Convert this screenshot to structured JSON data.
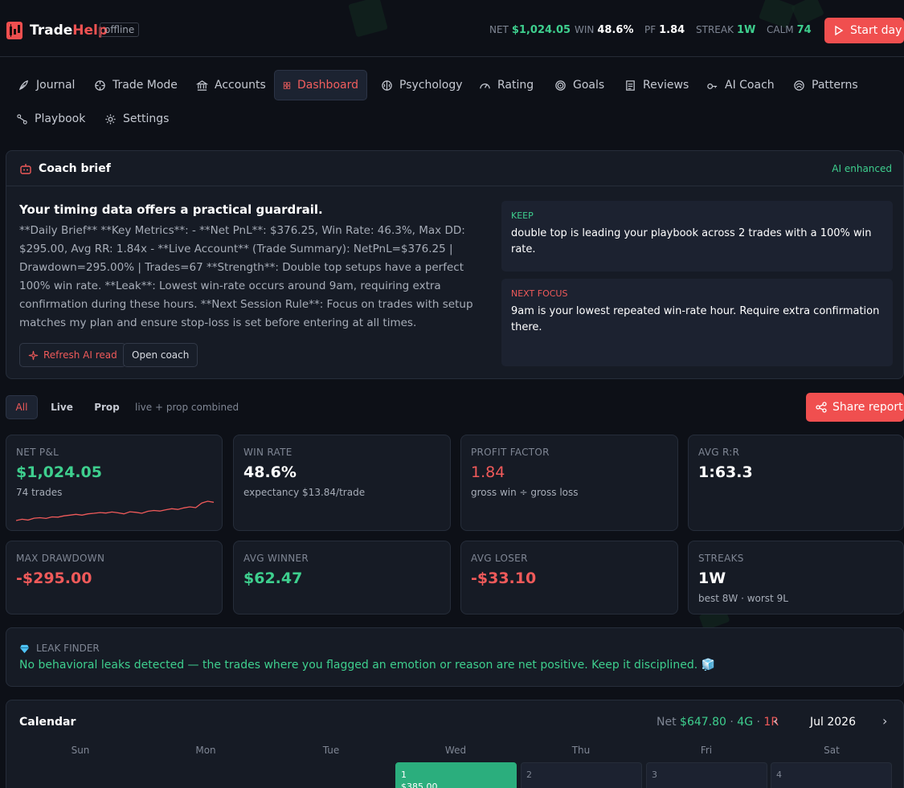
{
  "header": {
    "brand_part1": "Trade",
    "brand_part2": "Help",
    "status_badge": "offline",
    "stats": [
      {
        "label": "NET",
        "value": "$1,024.05",
        "color": "#3ecf8e"
      },
      {
        "label": "WIN",
        "value": "48.6%",
        "color": "#ffffff"
      },
      {
        "label": "PF",
        "value": "1.84",
        "color": "#ffffff"
      },
      {
        "label": "STREAK",
        "value": "1W",
        "color": "#3ecf8e"
      },
      {
        "label": "CALM",
        "value": "74",
        "color": "#3ecf8e"
      }
    ],
    "start_day_label": "Start day"
  },
  "nav": [
    {
      "label": "Journal",
      "icon": "feather-icon"
    },
    {
      "label": "Trade Mode",
      "icon": "crosshair-icon"
    },
    {
      "label": "Accounts",
      "icon": "bank-icon"
    },
    {
      "label": "Dashboard",
      "icon": "grid-icon",
      "active": true
    },
    {
      "label": "Psychology",
      "icon": "brain-icon"
    },
    {
      "label": "Rating",
      "icon": "gauge-icon"
    },
    {
      "label": "Goals",
      "icon": "target-icon"
    },
    {
      "label": "Reviews",
      "icon": "review-icon"
    },
    {
      "label": "AI Coach",
      "icon": "key-icon"
    },
    {
      "label": "Patterns",
      "icon": "pattern-icon"
    },
    {
      "label": "Playbook",
      "icon": "route-icon"
    },
    {
      "label": "Settings",
      "icon": "gear-icon"
    }
  ],
  "coach": {
    "title": "Coach brief",
    "badge": "AI enhanced",
    "headline": "Your timing data offers a practical guardrail.",
    "body": "**Daily Brief** **Key Metrics**: - **Net PnL**: $376.25, Win Rate: 46.3%, Max DD: $295.00, Avg RR: 1.84x - **Live Account** (Trade Summary): NetPnL=$376.25 | Drawdown=295.00% | Trades=67 **Strength**: Double top setups have a perfect 100% win rate. **Leak**: Lowest win-rate occurs around 9am, requiring extra confirmation during these hours. **Next Session Rule**: Focus on trades with setup matches my plan and ensure stop-loss is set before entering at all times.",
    "refresh_label": "Refresh AI read",
    "open_label": "Open coach",
    "keep_label": "KEEP",
    "keep_text": "double top is leading your playbook across 2 trades with a 100% win rate.",
    "focus_label": "NEXT FOCUS",
    "focus_text": "9am is your lowest repeated win-rate hour. Require extra confirmation there."
  },
  "filters": {
    "options": [
      "All",
      "Live",
      "Prop"
    ],
    "active": "All",
    "note": "live + prop combined",
    "share_label": "Share report"
  },
  "metrics": [
    {
      "label": "NET P&L",
      "value": "$1,024.05",
      "sub": "74 trades",
      "color": "#3ecf8e"
    },
    {
      "label": "WIN RATE",
      "value": "48.6%",
      "sub": "expectancy $13.84/trade",
      "color": "#ffffff"
    },
    {
      "label": "PROFIT FACTOR",
      "value": "1.84",
      "sub": "gross win ÷ gross loss",
      "color": "#f05a5a"
    },
    {
      "label": "AVG R:R",
      "value": "1:63.3",
      "sub": "",
      "color": "#ffffff"
    },
    {
      "label": "MAX DRAWDOWN",
      "value": "-$295.00",
      "sub": "",
      "color": "#f05a5a"
    },
    {
      "label": "AVG WINNER",
      "value": "$62.47",
      "sub": "",
      "color": "#3ecf8e"
    },
    {
      "label": "AVG LOSER",
      "value": "-$33.10",
      "sub": "",
      "color": "#f05a5a"
    },
    {
      "label": "STREAKS",
      "value": "1W",
      "sub": "best 8W · worst 9L",
      "color": "#ffffff"
    }
  ],
  "leak": {
    "label": "LEAK FINDER",
    "text": "No behavioral leaks detected — the trades where you flagged an emotion or reason are net positive. Keep it disciplined. 🧊"
  },
  "calendar": {
    "title": "Calendar",
    "net_label": "Net",
    "net_value": "$647.80",
    "wins": "4G",
    "losses": "1R",
    "month": "Jul 2026",
    "weekdays": [
      "Sun",
      "Mon",
      "Tue",
      "Wed",
      "Thu",
      "Fri",
      "Sat"
    ],
    "days": [
      {
        "num": "1",
        "value": "$385.00",
        "win": true
      },
      {
        "num": "2",
        "value": ""
      },
      {
        "num": "3",
        "value": ""
      },
      {
        "num": "4",
        "value": ""
      }
    ]
  },
  "sparkline": [
    0,
    0.5,
    0.2,
    0.9,
    1.1,
    0.8,
    1.4,
    1.3,
    1.8,
    2.1,
    2.4,
    2.1,
    2.6,
    2.8,
    3.1,
    2.9,
    3.3,
    3.0,
    2.6,
    3.4,
    3.2,
    2.8,
    3.6,
    3.9,
    3.7,
    4.2,
    4.6,
    4.3,
    4.9,
    5.3,
    5.0,
    6.8,
    7.5,
    7.1
  ]
}
